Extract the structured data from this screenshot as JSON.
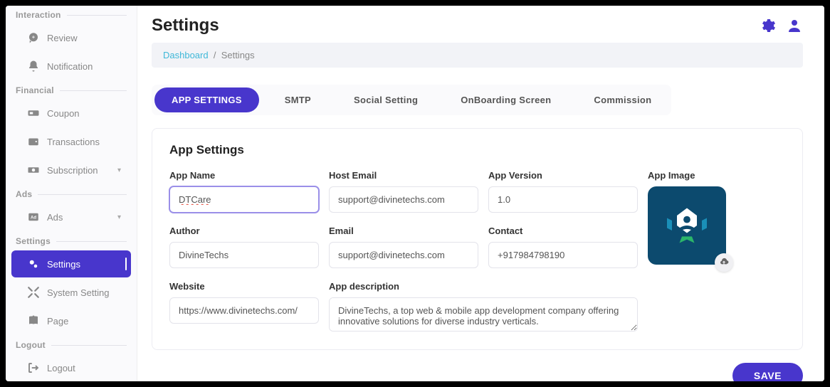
{
  "header": {
    "title": "Settings"
  },
  "breadcrumb": {
    "home": "Dashboard",
    "current": "Settings"
  },
  "sidebar": {
    "sections": [
      {
        "label": "Interaction",
        "items": [
          {
            "label": "Review",
            "icon": "chat"
          },
          {
            "label": "Notification",
            "icon": "bell"
          }
        ]
      },
      {
        "label": "Financial",
        "items": [
          {
            "label": "Coupon",
            "icon": "ticket"
          },
          {
            "label": "Transactions",
            "icon": "wallet"
          },
          {
            "label": "Subscription",
            "icon": "cash",
            "chevron": true
          }
        ]
      },
      {
        "label": "Ads",
        "items": [
          {
            "label": "Ads",
            "icon": "ad",
            "chevron": true
          }
        ]
      },
      {
        "label": "Settings",
        "items": [
          {
            "label": "Settings",
            "icon": "gears",
            "active": true
          },
          {
            "label": "System Setting",
            "icon": "tools"
          },
          {
            "label": "Page",
            "icon": "book"
          }
        ]
      },
      {
        "label": "Logout",
        "items": [
          {
            "label": "Logout",
            "icon": "logout"
          }
        ]
      }
    ]
  },
  "tabs": [
    {
      "label": "APP SETTINGS",
      "active": true
    },
    {
      "label": "SMTP"
    },
    {
      "label": "Social Setting"
    },
    {
      "label": "OnBoarding Screen"
    },
    {
      "label": "Commission"
    }
  ],
  "card": {
    "title": "App Settings"
  },
  "form": {
    "app_name": {
      "label": "App Name",
      "value": "DTCare"
    },
    "host_email": {
      "label": "Host Email",
      "value": "support@divinetechs.com"
    },
    "app_version": {
      "label": "App Version",
      "value": "1.0"
    },
    "author": {
      "label": "Author",
      "value": "DivineTechs"
    },
    "email": {
      "label": "Email",
      "value": "support@divinetechs.com"
    },
    "contact": {
      "label": "Contact",
      "value": "+917984798190"
    },
    "website": {
      "label": "Website",
      "value": "https://www.divinetechs.com/"
    },
    "app_desc": {
      "label": "App description",
      "value": "DivineTechs, a top web & mobile app development company offering innovative solutions for diverse industry verticals."
    },
    "app_image": {
      "label": "App Image"
    }
  },
  "buttons": {
    "save": "SAVE"
  },
  "colors": {
    "accent": "#4836cc",
    "link": "#3fb8d8"
  }
}
